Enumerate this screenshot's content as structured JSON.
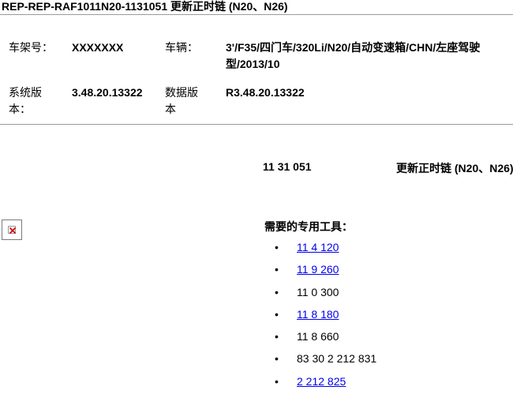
{
  "header": {
    "title": "REP-REP-RAF1011N20-1131051   更新正时链 (N20、N26)"
  },
  "meta": {
    "chassis_label": "车架号：",
    "chassis_value": "XXXXXXX",
    "vehicle_label": "车辆：",
    "vehicle_value": "3'/F35/四门车/320Li/N20/自动变速箱/CHN/左座驾驶型/2013/10",
    "system_version_label": "系统版本：",
    "system_version_value": "3.48.20.13322",
    "data_version_label": "数据版本",
    "data_version_value": "R3.48.20.13322"
  },
  "operation": {
    "number": "11 31 051",
    "title": "更新正时链 (N20、N26)"
  },
  "tools": {
    "heading": "需要的专用工具：",
    "bullet": "•",
    "items": [
      {
        "label": "11 4 120",
        "link": true
      },
      {
        "label": "11 9 260",
        "link": true
      },
      {
        "label": "11 0 300",
        "link": false
      },
      {
        "label": "11 8 180",
        "link": true
      },
      {
        "label": "11 8 660",
        "link": false
      },
      {
        "label": "83 30 2 212 831",
        "link": false
      },
      {
        "label": "2 212 825",
        "link": true
      }
    ]
  },
  "colors": {
    "link": "#0000ee",
    "divider": "#9a9a9a",
    "broken_image_x": "#cc0000"
  },
  "icons": {
    "broken_image": "broken-image-icon"
  }
}
